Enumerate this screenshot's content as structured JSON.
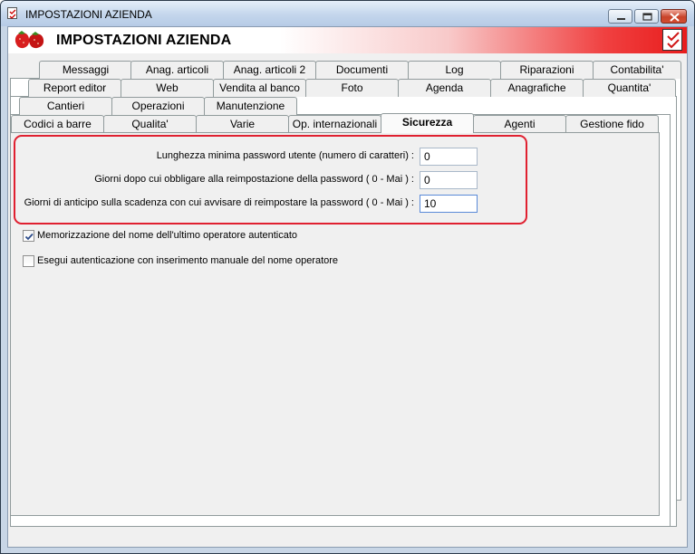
{
  "window": {
    "title": "IMPOSTAZIONI AZIENDA"
  },
  "header": {
    "title": "IMPOSTAZIONI AZIENDA"
  },
  "tabs": {
    "row1": [
      "Messaggi",
      "Anag. articoli",
      "Anag. articoli 2",
      "Documenti",
      "Log",
      "Riparazioni",
      "Contabilita'"
    ],
    "row2": [
      "Report editor",
      "Web",
      "Vendita al banco",
      "Foto",
      "Agenda",
      "Anagrafiche",
      "Quantita'"
    ],
    "row3": [
      "Cantieri",
      "Operazioni",
      "Manutenzione"
    ],
    "row4": [
      "Codici a barre",
      "Qualita'",
      "Varie",
      "Op. internazionali",
      "Sicurezza",
      "Agenti",
      "Gestione fido"
    ],
    "selected": "Sicurezza"
  },
  "security": {
    "fields": [
      {
        "label": "Lunghezza minima password utente (numero di caratteri) :",
        "value": "0"
      },
      {
        "label": "Giorni dopo cui obbligare alla reimpostazione della password ( 0 - Mai ) :",
        "value": "0"
      },
      {
        "label": "Giorni di anticipo sulla scadenza con cui avvisare di reimpostare la password ( 0 - Mai ) :",
        "value": "10"
      }
    ],
    "checkboxes": [
      {
        "label": "Memorizzazione del nome dell'ultimo operatore autenticato",
        "checked": true
      },
      {
        "label": "Esegui autenticazione con inserimento manuale del nome operatore",
        "checked": false
      }
    ]
  },
  "colors": {
    "accent_red": "#e02030",
    "title_bar": "#c4d6ec"
  }
}
